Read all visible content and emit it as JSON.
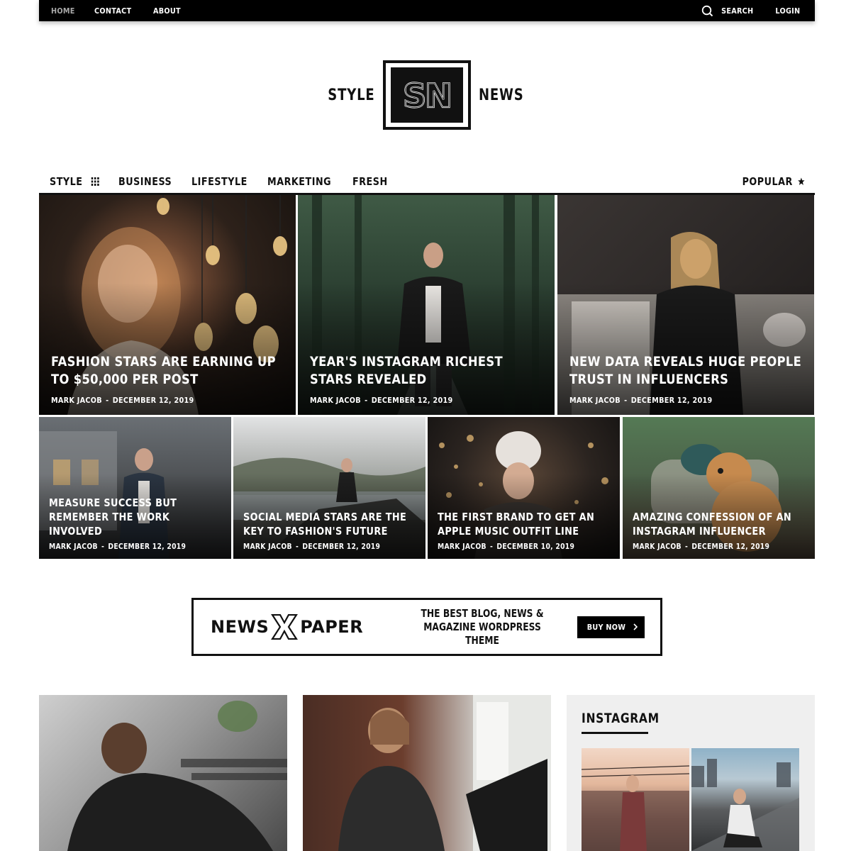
{
  "topbar": {
    "links": [
      "HOME",
      "CONTACT",
      "ABOUT"
    ],
    "search_label": "SEARCH",
    "login_label": "LOGIN"
  },
  "logo": {
    "left_word": "STYLE",
    "monogram": "SN",
    "right_word": "NEWS"
  },
  "catnav": {
    "items": [
      "STYLE",
      "BUSINESS",
      "LIFESTYLE",
      "MARKETING",
      "FRESH"
    ],
    "popular": "POPULAR"
  },
  "featured": [
    {
      "title": "FASHION STARS ARE EARNING UP TO $50,000 PER POST",
      "author": "MARK JACOB",
      "date": "DECEMBER 12, 2019"
    },
    {
      "title": "YEAR'S INSTAGRAM RICHEST STARS REVEALED",
      "author": "MARK JACOB",
      "date": "DECEMBER 12, 2019"
    },
    {
      "title": "NEW DATA REVEALS HUGE PEOPLE TRUST IN INFLUENCERS",
      "author": "MARK JACOB",
      "date": "DECEMBER 12, 2019"
    }
  ],
  "secondary": [
    {
      "title": "MEASURE SUCCESS BUT REMEMBER THE WORK INVOLVED",
      "author": "MARK JACOB",
      "date": "DECEMBER 12, 2019"
    },
    {
      "title": "SOCIAL MEDIA STARS ARE THE KEY TO FASHION'S FUTURE",
      "author": "MARK JACOB",
      "date": "DECEMBER 12, 2019"
    },
    {
      "title": "THE FIRST BRAND TO GET AN APPLE MUSIC OUTFIT LINE",
      "author": "MARK JACOB",
      "date": "DECEMBER 10, 2019"
    },
    {
      "title": "AMAZING CONFESSION OF AN INSTAGRAM INFLUENCER",
      "author": "MARK JACOB",
      "date": "DECEMBER 12, 2019"
    }
  ],
  "ad": {
    "brand_left": "NEWS",
    "brand_mid": "X",
    "brand_right": "PAPER",
    "tagline_1": "THE BEST BLOG, NEWS &",
    "tagline_2": "MAGAZINE WORDPRESS THEME",
    "button": "BUY NOW"
  },
  "instagram": {
    "heading": "INSTAGRAM"
  },
  "colors": {
    "bar": "#000000",
    "text": "#111111",
    "muted": "#aaaaaa",
    "panel": "#efefef"
  }
}
